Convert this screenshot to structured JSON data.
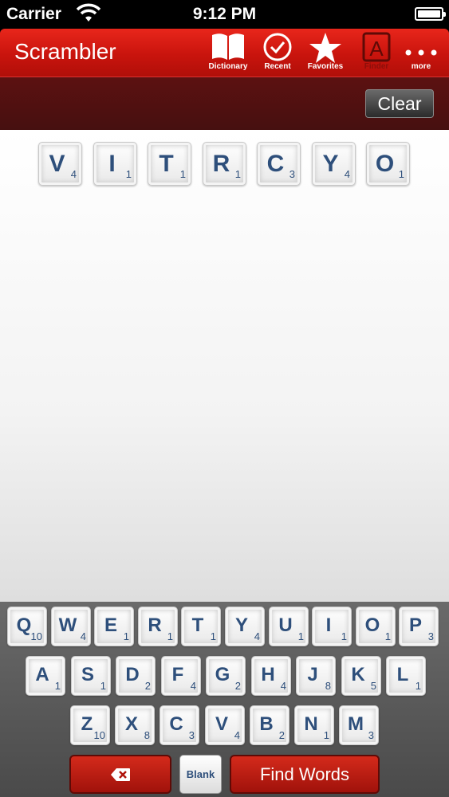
{
  "status": {
    "carrier": "Carrier",
    "time": "9:12 PM"
  },
  "nav": {
    "title": "Scrambler",
    "buttons": [
      {
        "label": "Dictionary",
        "icon": "book-icon"
      },
      {
        "label": "Recent",
        "icon": "check-circle-icon"
      },
      {
        "label": "Favorites",
        "icon": "star-icon"
      },
      {
        "label": "Finder",
        "icon": "letter-a-icon"
      },
      {
        "label": "more",
        "icon": "more-dots-icon"
      }
    ]
  },
  "toolbar": {
    "clear_label": "Clear"
  },
  "board": {
    "tiles": [
      {
        "letter": "V",
        "score": "4"
      },
      {
        "letter": "I",
        "score": "1"
      },
      {
        "letter": "T",
        "score": "1"
      },
      {
        "letter": "R",
        "score": "1"
      },
      {
        "letter": "C",
        "score": "3"
      },
      {
        "letter": "Y",
        "score": "4"
      },
      {
        "letter": "O",
        "score": "1"
      }
    ]
  },
  "keyboard": {
    "rows": [
      [
        {
          "letter": "Q",
          "score": "10"
        },
        {
          "letter": "W",
          "score": "4"
        },
        {
          "letter": "E",
          "score": "1"
        },
        {
          "letter": "R",
          "score": "1"
        },
        {
          "letter": "T",
          "score": "1"
        },
        {
          "letter": "Y",
          "score": "4"
        },
        {
          "letter": "U",
          "score": "1"
        },
        {
          "letter": "I",
          "score": "1"
        },
        {
          "letter": "O",
          "score": "1"
        },
        {
          "letter": "P",
          "score": "3"
        }
      ],
      [
        {
          "letter": "A",
          "score": "1"
        },
        {
          "letter": "S",
          "score": "1"
        },
        {
          "letter": "D",
          "score": "2"
        },
        {
          "letter": "F",
          "score": "4"
        },
        {
          "letter": "G",
          "score": "2"
        },
        {
          "letter": "H",
          "score": "4"
        },
        {
          "letter": "J",
          "score": "8"
        },
        {
          "letter": "K",
          "score": "5"
        },
        {
          "letter": "L",
          "score": "1"
        }
      ],
      [
        {
          "letter": "Z",
          "score": "10"
        },
        {
          "letter": "X",
          "score": "8"
        },
        {
          "letter": "C",
          "score": "3"
        },
        {
          "letter": "V",
          "score": "4"
        },
        {
          "letter": "B",
          "score": "2"
        },
        {
          "letter": "N",
          "score": "1"
        },
        {
          "letter": "M",
          "score": "3"
        }
      ]
    ],
    "blank_label": "Blank",
    "find_label": "Find Words",
    "delete_icon": "backspace-icon"
  },
  "colors": {
    "accent": "#c9140d",
    "tile_text": "#2e4f7b",
    "toolbar": "#4f1010"
  }
}
